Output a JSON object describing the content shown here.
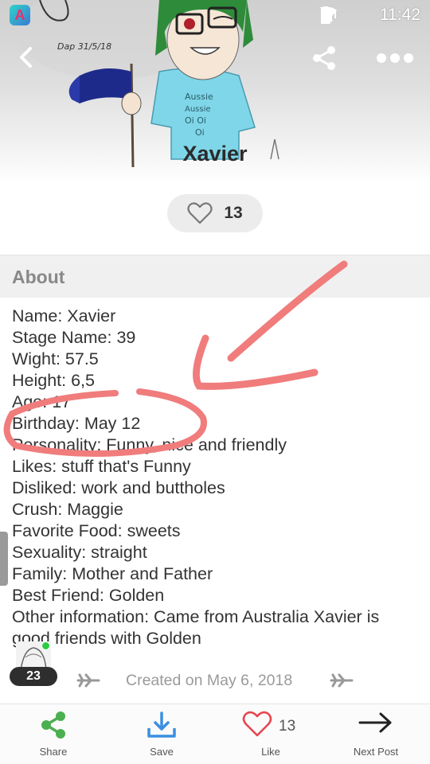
{
  "status_bar": {
    "time": "11:42",
    "app_badge": "A"
  },
  "header": {
    "back_icon": "chevron-left-icon",
    "share_icon": "share-icon",
    "more_icon": "more-dots-icon",
    "artwork_signature": "Dap 31/5/18",
    "shirt_text": "Aussie Aussie Oi Oi Oi"
  },
  "title": "Xavier",
  "likes": {
    "count": "13",
    "icon": "heart-outline-icon"
  },
  "about": {
    "heading": "About",
    "lines": [
      "Name: Xavier",
      "Stage Name: 39",
      "Wight: 57.5",
      "Height: 6,5",
      "Age: 17",
      "Birthday: May 12",
      "Personality: Funny, nice and friendly",
      "Likes: stuff that's Funny",
      "Disliked: work and buttholes",
      "Crush: Maggie",
      "Favorite Food: sweets",
      "Sexuality: straight",
      "Family: Mother and Father",
      "Best Friend: Golden",
      "Other information: Came from Australia Xavier is",
      "good friends with Golden"
    ]
  },
  "footer_meta": {
    "level": "23",
    "created": "Created on May 6, 2018"
  },
  "bottom_bar": {
    "share_label": "Share",
    "save_label": "Save",
    "like_label": "Like",
    "like_count": "13",
    "next_label": "Next Post"
  },
  "colors": {
    "share_green": "#4caf50",
    "save_blue": "#3b8fe0",
    "like_red": "#e8454f",
    "annotation_pink": "#f07c7c"
  }
}
